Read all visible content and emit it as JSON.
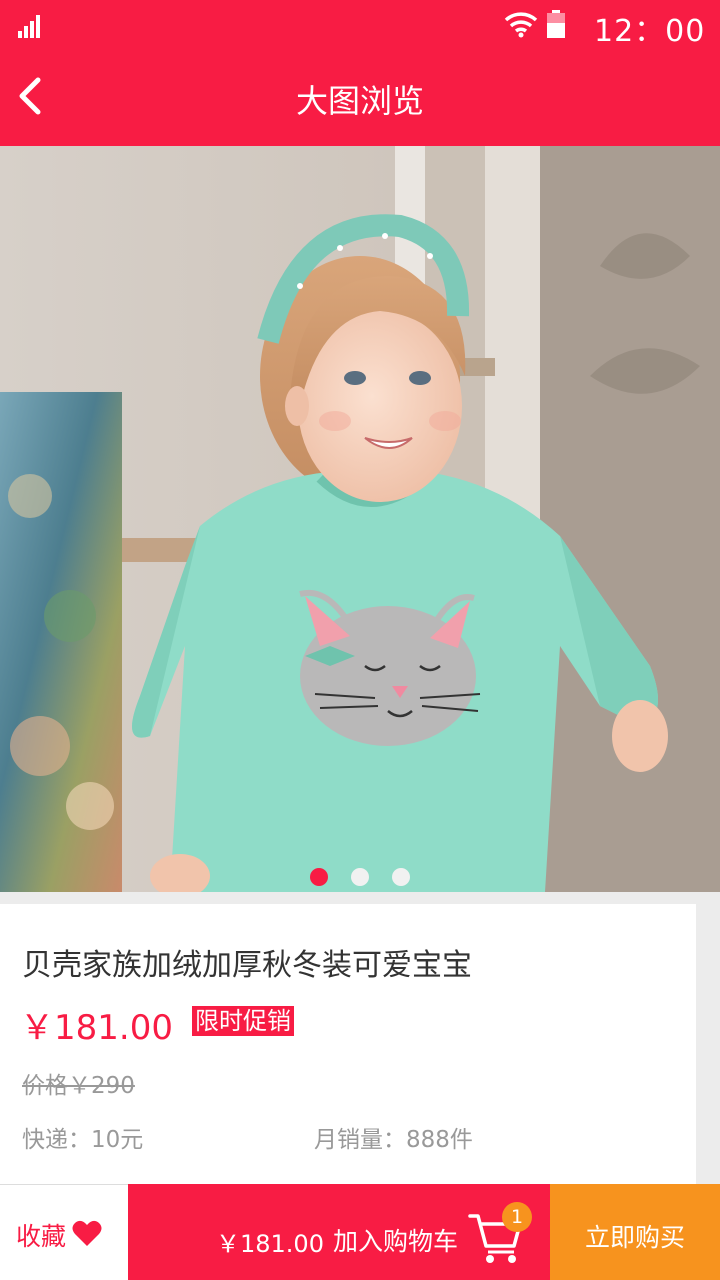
{
  "status_bar": {
    "time": "12：00"
  },
  "header": {
    "title": "大图浏览"
  },
  "gallery": {
    "total_images": 3,
    "active_index": 0
  },
  "product": {
    "name": "贝壳家族加绒加厚秋冬装可爱宝宝",
    "price": "￥181.00",
    "promo_tag": "限时促销",
    "original_price": "价格￥290",
    "shipping": "快递：10元",
    "monthly_sales": "月销量：888件"
  },
  "bottom_bar": {
    "favorite_label": "收藏",
    "cart_price": "￥181.00",
    "add_to_cart_label": "加入购物车",
    "cart_count": "1",
    "buy_now_label": "立即购买"
  },
  "colors": {
    "accent": "#f81c44",
    "secondary": "#f7931e",
    "background": "#ececec"
  }
}
